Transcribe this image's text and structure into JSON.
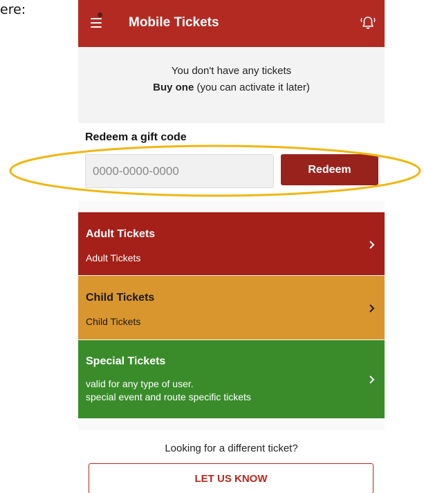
{
  "doc_text": "ere:",
  "header": {
    "title": "Mobile Tickets",
    "brand_color": "#b32a22"
  },
  "empty_state": {
    "line1": "You don't have any tickets",
    "line2_bold": "Buy one",
    "line2_rest": " (you can activate it later)"
  },
  "redeem": {
    "title": "Redeem a gift code",
    "placeholder": "0000-0000-0000",
    "button_label": "Redeem"
  },
  "tickets": [
    {
      "title": "Adult Tickets",
      "subtitle_lines": [
        "Adult Tickets"
      ],
      "color": "#a42019"
    },
    {
      "title": "Child Tickets",
      "subtitle_lines": [
        "Child Tickets"
      ],
      "color": "#d9962e"
    },
    {
      "title": "Special Tickets",
      "subtitle_lines": [
        "valid for any type of user.",
        "special event and route specific tickets"
      ],
      "color": "#3a8c2b"
    }
  ],
  "footer": {
    "question": "Looking for a different ticket?",
    "button_label": "LET US KNOW"
  },
  "annotation_color": "#f2b60f",
  "icons": [
    "menu-icon",
    "bell-icon",
    "chevron-right-icon"
  ]
}
